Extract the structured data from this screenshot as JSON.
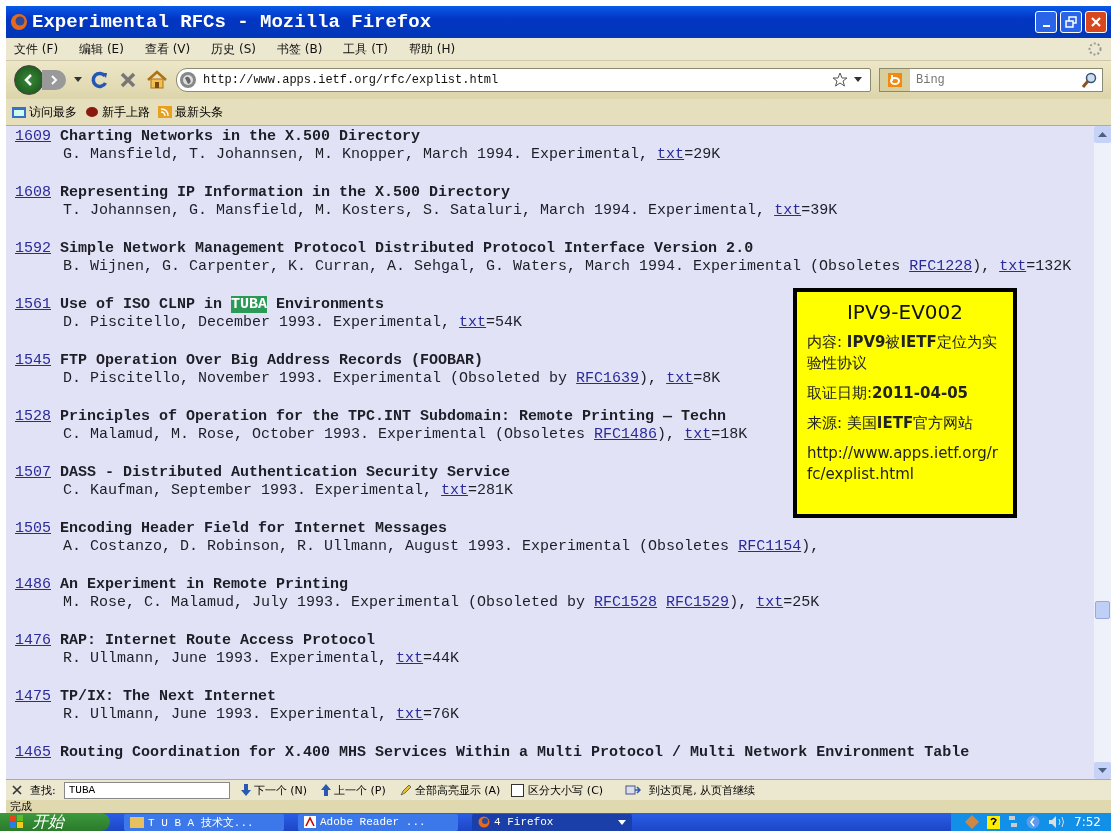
{
  "window": {
    "title": "Experimental RFCs - Mozilla Firefox"
  },
  "menu": [
    "文件 (F)",
    "编辑 (E)",
    "查看 (V)",
    "历史 (S)",
    "书签 (B)",
    "工具 (T)",
    "帮助 (H)"
  ],
  "address_bar": {
    "url": "http://www.apps.ietf.org/rfc/explist.html"
  },
  "search_bar": {
    "placeholder": "Bing"
  },
  "bookmarks": [
    "访问最多",
    "新手上路",
    "最新头条"
  ],
  "entries": [
    {
      "number": "1609",
      "title": [
        {
          "text": "Charting Networks in the X.500 Directory",
          "highlight": false
        }
      ],
      "details": [
        {
          "text": "G. Mansfield, T. Johannsen, M. Knopper, March 1994. Experimental, ",
          "link": false
        },
        {
          "text": "txt",
          "link": true
        },
        {
          "text": "=29K",
          "link": false
        }
      ]
    },
    {
      "number": "1608",
      "title": [
        {
          "text": "Representing IP Information in the X.500 Directory",
          "highlight": false
        }
      ],
      "details": [
        {
          "text": "T. Johannsen, G. Mansfield, M. Kosters, S. Sataluri, March 1994. Experimental, ",
          "link": false
        },
        {
          "text": "txt",
          "link": true
        },
        {
          "text": "=39K",
          "link": false
        }
      ]
    },
    {
      "number": "1592",
      "title": [
        {
          "text": "Simple Network Management Protocol Distributed Protocol Interface Version 2.0",
          "highlight": false
        }
      ],
      "details": [
        {
          "text": "B. Wijnen, G. Carpenter, K. Curran, A. Sehgal, G. Waters, March 1994. Experimental (Obsoletes ",
          "link": false
        },
        {
          "text": "RFC1228",
          "link": true
        },
        {
          "text": "), ",
          "link": false
        },
        {
          "text": "txt",
          "link": true
        },
        {
          "text": "=132K",
          "link": false
        }
      ]
    },
    {
      "number": "1561",
      "title": [
        {
          "text": "Use of ISO CLNP in ",
          "highlight": false
        },
        {
          "text": "TUBA",
          "highlight": true
        },
        {
          "text": " Environments",
          "highlight": false
        }
      ],
      "details": [
        {
          "text": "D. Piscitello, December 1993. Experimental, ",
          "link": false
        },
        {
          "text": "txt",
          "link": true
        },
        {
          "text": "=54K",
          "link": false
        }
      ]
    },
    {
      "number": "1545",
      "title": [
        {
          "text": "FTP Operation Over Big Address Records (FOOBAR)",
          "highlight": false
        }
      ],
      "details": [
        {
          "text": "D. Piscitello, November 1993. Experimental (Obsoleted by ",
          "link": false
        },
        {
          "text": "RFC1639",
          "link": true
        },
        {
          "text": "), ",
          "link": false
        },
        {
          "text": "txt",
          "link": true
        },
        {
          "text": "=8K",
          "link": false
        }
      ]
    },
    {
      "number": "1528",
      "title": [
        {
          "text": "Principles of Operation for the TPC.INT Subdomain: Remote Printing — Techn",
          "highlight": false
        }
      ],
      "details": [
        {
          "text": "C. Malamud, M. Rose, October 1993. Experimental (Obsoletes ",
          "link": false
        },
        {
          "text": "RFC1486",
          "link": true
        },
        {
          "text": "), ",
          "link": false
        },
        {
          "text": "txt",
          "link": true
        },
        {
          "text": "=18K",
          "link": false
        }
      ]
    },
    {
      "number": "1507",
      "title": [
        {
          "text": "DASS - Distributed Authentication Security Service",
          "highlight": false
        }
      ],
      "details": [
        {
          "text": "C. Kaufman, September 1993. Experimental, ",
          "link": false
        },
        {
          "text": "txt",
          "link": true
        },
        {
          "text": "=281K",
          "link": false
        }
      ]
    },
    {
      "number": "1505",
      "title": [
        {
          "text": "Encoding Header Field for Internet Messages",
          "highlight": false
        }
      ],
      "details": [
        {
          "text": "A. Costanzo, D. Robinson, R. Ullmann, August 1993. Experimental (Obsoletes ",
          "link": false
        },
        {
          "text": "RFC1154",
          "link": true
        },
        {
          "text": "),",
          "link": false
        }
      ]
    },
    {
      "number": "1486",
      "title": [
        {
          "text": "An Experiment in Remote Printing",
          "highlight": false
        }
      ],
      "details": [
        {
          "text": "M. Rose, C. Malamud, July 1993. Experimental (Obsoleted by ",
          "link": false
        },
        {
          "text": "RFC1528",
          "link": true
        },
        {
          "text": "RFC1529",
          "link": true
        },
        {
          "text": "), ",
          "link": false
        },
        {
          "text": "txt",
          "link": true
        },
        {
          "text": "=25K",
          "link": false
        }
      ]
    },
    {
      "number": "1476",
      "title": [
        {
          "text": "RAP: Internet Route Access Protocol",
          "highlight": false
        }
      ],
      "details": [
        {
          "text": "R. Ullmann, June 1993. Experimental, ",
          "link": false
        },
        {
          "text": "txt",
          "link": true
        },
        {
          "text": "=44K",
          "link": false
        }
      ]
    },
    {
      "number": "1475",
      "title": [
        {
          "text": "TP/IX: The Next Internet",
          "highlight": false
        }
      ],
      "details": [
        {
          "text": "R. Ullmann, June 1993. Experimental, ",
          "link": false
        },
        {
          "text": "txt",
          "link": true
        },
        {
          "text": "=76K",
          "link": false
        }
      ]
    },
    {
      "number": "1465",
      "title": [
        {
          "text": "Routing Coordination for X.400 MHS Services Within a Multi Protocol / Multi Network Environment Table",
          "highlight": false
        }
      ]
    }
  ],
  "overlay_note": {
    "title": "IPV9-EV002",
    "lines": [
      "内容: **IPV9**被**IETF**定位为实验性协议",
      "取证日期:**2011-04-05**",
      "来源: 美国**IETF**官方网站",
      "http://www.apps.ietf.org/rfc/explist.html"
    ]
  },
  "find_bar": {
    "label": "查找:",
    "query": "TUBA",
    "buttons": [
      "下一个 (N)",
      "上一个 (P)",
      "全部高亮显示 (A)"
    ],
    "match_case": {
      "label": "区分大小写 (C)",
      "checked": false
    },
    "message": "到达页尾, 从页首继续"
  },
  "status_bar": "完成",
  "taskbar": {
    "start": "开始",
    "tasks": [
      {
        "label": "T U B A 技术文...",
        "selected": false
      },
      {
        "label": "Adobe Reader ...",
        "selected": false
      },
      {
        "label": "4 Firefox",
        "selected": true
      }
    ],
    "clock": "7:52"
  }
}
